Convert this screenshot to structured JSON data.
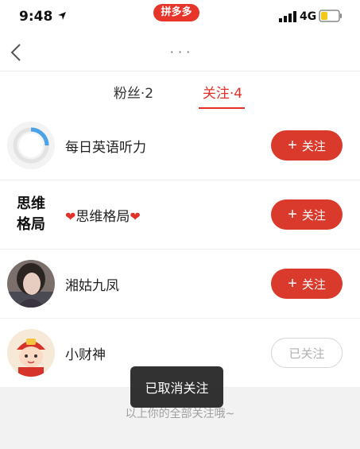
{
  "status_bar": {
    "time": "9:48",
    "app_badge": "拼多多",
    "network": "4G"
  },
  "nav": {
    "title": "· · ·"
  },
  "tabs": [
    {
      "label": "粉丝·2",
      "active": false
    },
    {
      "label": "关注·4",
      "active": true
    }
  ],
  "users": [
    {
      "name": "每日英语听力",
      "button_label": "关注",
      "followed": false
    },
    {
      "name": "思维格局",
      "button_label": "关注",
      "followed": false,
      "avatar_text": [
        "思维",
        "格局"
      ]
    },
    {
      "name": "湘姑九凤",
      "button_label": "关注",
      "followed": false
    },
    {
      "name": "小财神",
      "button_label": "已关注",
      "followed": true
    }
  ],
  "footer": {
    "text": "以上你的全部关注哦~"
  },
  "toast": {
    "text": "已取消关注"
  },
  "colors": {
    "accent": "#e0312a",
    "follow_button": "#d93a2c",
    "footer_bg": "#f2f2f2"
  }
}
